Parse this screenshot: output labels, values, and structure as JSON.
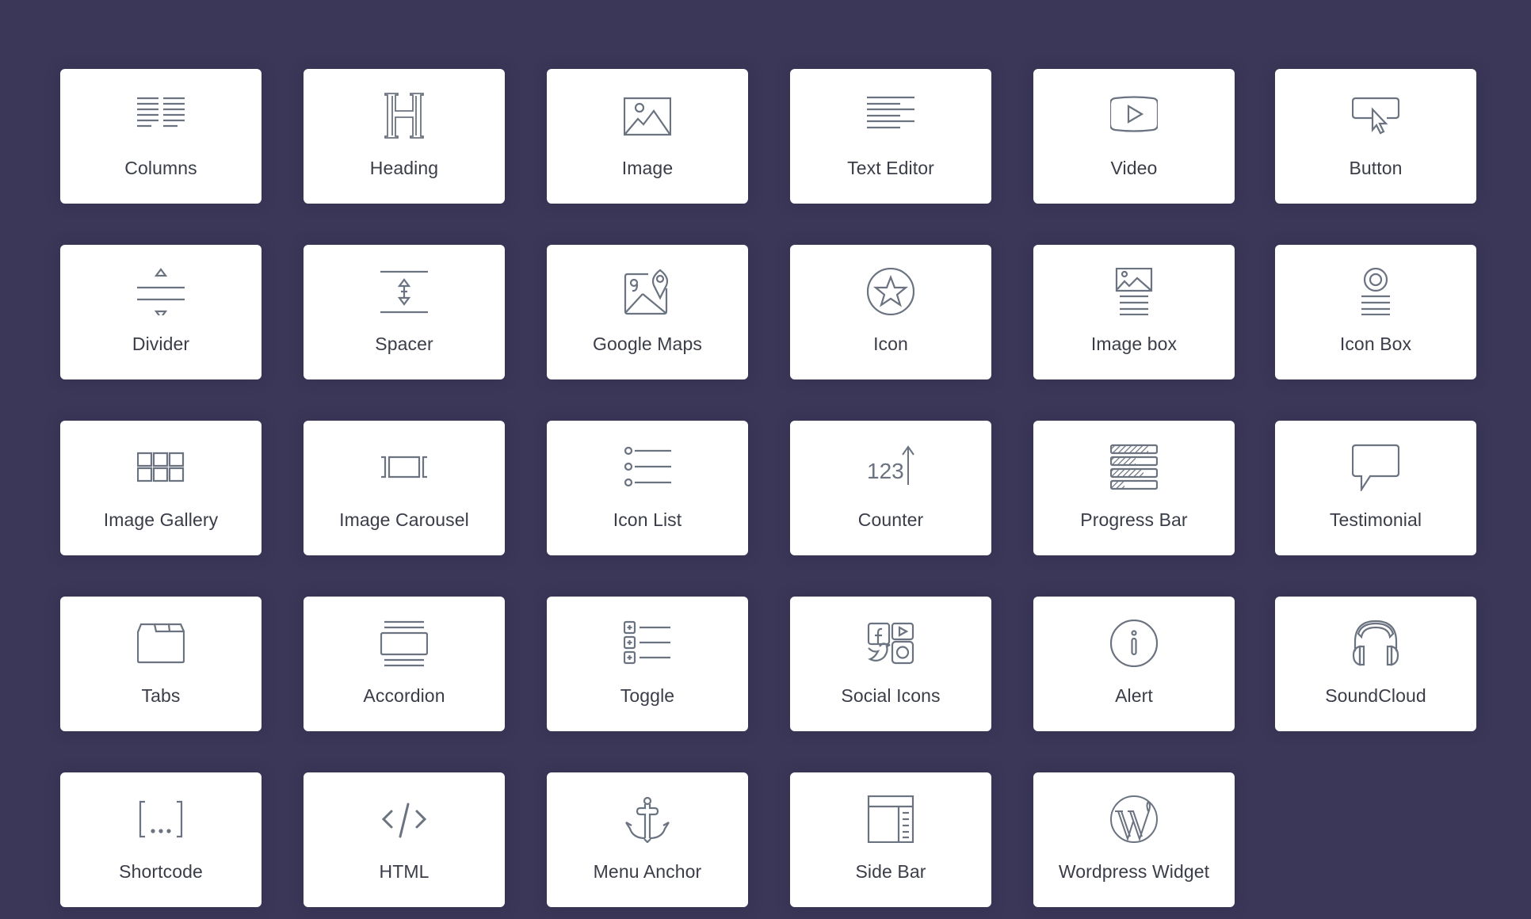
{
  "page": {
    "background": "#3b3758",
    "icon_color": "#6b7380",
    "label_color": "#3a3d48"
  },
  "widgets": [
    {
      "label": "Columns",
      "icon": "columns-icon"
    },
    {
      "label": "Heading",
      "icon": "heading-icon"
    },
    {
      "label": "Image",
      "icon": "image-icon"
    },
    {
      "label": "Text Editor",
      "icon": "text-editor-icon"
    },
    {
      "label": "Video",
      "icon": "video-icon"
    },
    {
      "label": "Button",
      "icon": "button-icon"
    },
    {
      "label": "Divider",
      "icon": "divider-icon"
    },
    {
      "label": "Spacer",
      "icon": "spacer-icon"
    },
    {
      "label": "Google Maps",
      "icon": "google-maps-icon"
    },
    {
      "label": "Icon",
      "icon": "star-icon"
    },
    {
      "label": "Image box",
      "icon": "image-box-icon"
    },
    {
      "label": "Icon Box",
      "icon": "icon-box-icon"
    },
    {
      "label": "Image Gallery",
      "icon": "image-gallery-icon"
    },
    {
      "label": "Image Carousel",
      "icon": "image-carousel-icon"
    },
    {
      "label": "Icon List",
      "icon": "icon-list-icon"
    },
    {
      "label": "Counter",
      "icon": "counter-icon"
    },
    {
      "label": "Progress Bar",
      "icon": "progress-bar-icon"
    },
    {
      "label": "Testimonial",
      "icon": "testimonial-icon"
    },
    {
      "label": "Tabs",
      "icon": "tabs-icon"
    },
    {
      "label": "Accordion",
      "icon": "accordion-icon"
    },
    {
      "label": "Toggle",
      "icon": "toggle-icon"
    },
    {
      "label": "Social Icons",
      "icon": "social-icons-icon"
    },
    {
      "label": "Alert",
      "icon": "alert-icon"
    },
    {
      "label": "SoundCloud",
      "icon": "soundcloud-icon"
    },
    {
      "label": "Shortcode",
      "icon": "shortcode-icon"
    },
    {
      "label": "HTML",
      "icon": "html-icon"
    },
    {
      "label": "Menu Anchor",
      "icon": "anchor-icon"
    },
    {
      "label": "Side Bar",
      "icon": "sidebar-icon"
    },
    {
      "label": "Wordpress Widget",
      "icon": "wordpress-icon"
    }
  ],
  "counter_icon_text": "123"
}
